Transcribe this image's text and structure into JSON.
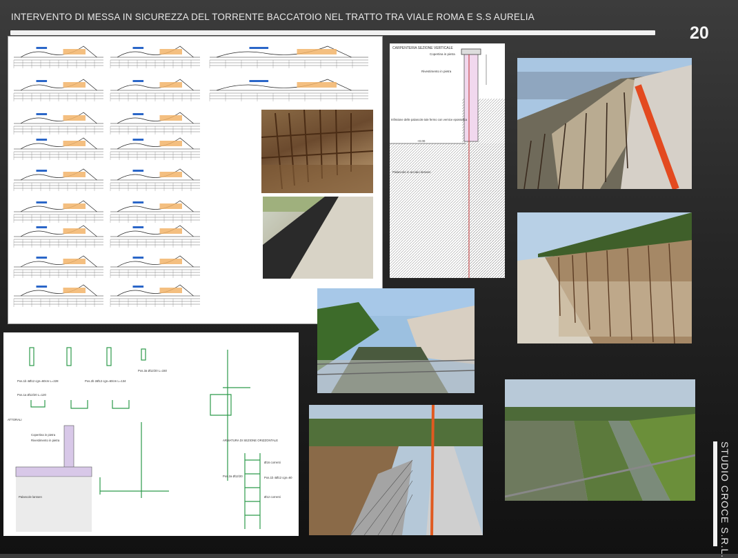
{
  "header": {
    "title": "INTERVENTO DI MESSA IN SICUREZZA DEL TORRENTE BACCATOIO NEL TRATTO TRA VIALE ROMA E S.S AURELIA",
    "page_number": "20"
  },
  "sidebar": {
    "company": "STUDIO CROCE S.R.L."
  },
  "section_drawing": {
    "title": "CARPENTERIA SEZIONE VERTICALE",
    "labels": [
      "Copertina in pietra",
      "Rivestimento in pietra",
      "Infissione delle palancole tale fermo con vernice epossidica",
      "Palancole in acciaio larssen"
    ],
    "level": "+0.00"
  },
  "rebar_drawing": {
    "labels": [
      "Pos.1b 4Ø12 cgn=60cm L=228",
      "Pos.2b 2Ø12 cgn=60cm L=134",
      "Pos.3a Ø12/20 L=150",
      "Pos.1a Ø12/20 L=120",
      "ATTORALI",
      "Copertina in pietra",
      "Rivestimento in pietra",
      "Palancole larssen",
      "ARMATURA DI SEZIONE ORIZZONTALE",
      "Ø16 correnti",
      "Ø12 correnti",
      "Pos.2a Ø12/20",
      "Pos.1b 4Ø12 cgn=60"
    ]
  }
}
